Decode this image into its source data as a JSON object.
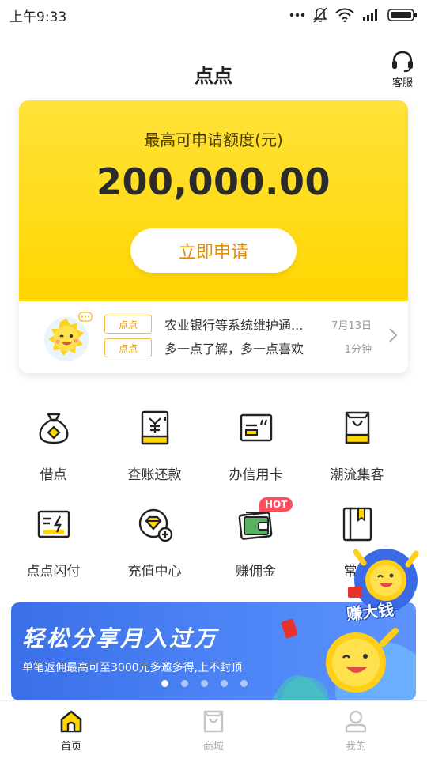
{
  "status_bar": {
    "time": "上午9:33"
  },
  "header": {
    "title": "点点",
    "service_label": "客服"
  },
  "hero": {
    "limit_label": "最高可申请额度(元)",
    "limit_amount": "200,000.00",
    "apply_label": "立即申请"
  },
  "notices": [
    {
      "tag": "点点",
      "text": "农业银行等系统维护通...",
      "time": "7月13日"
    },
    {
      "tag": "点点",
      "text": "多一点了解，多一点喜欢",
      "time": "1分钟"
    }
  ],
  "grid": [
    {
      "label": "借点",
      "icon": "money-bag-icon"
    },
    {
      "label": "查账还款",
      "icon": "bill-icon"
    },
    {
      "label": "办信用卡",
      "icon": "credit-card-icon"
    },
    {
      "label": "潮流集客",
      "icon": "shopping-bag-icon"
    },
    {
      "label": "点点闪付",
      "icon": "flash-pay-icon"
    },
    {
      "label": "充值中心",
      "icon": "recharge-icon"
    },
    {
      "label": "赚佣金",
      "icon": "wallet-icon",
      "badge": "HOT"
    },
    {
      "label": "常见",
      "icon": "book-icon"
    }
  ],
  "banner": {
    "title": "轻松分享月入过万",
    "subtitle": "单笔返佣最高可至3000元多邀多得,上不封顶",
    "dot_count": 5,
    "active_dot": 0
  },
  "earn_float_label": "赚大钱",
  "tabs": [
    {
      "label": "首页",
      "icon": "home-icon",
      "active": true
    },
    {
      "label": "商城",
      "icon": "mall-icon",
      "active": false
    },
    {
      "label": "我的",
      "icon": "profile-icon",
      "active": false
    }
  ],
  "colors": {
    "brand_yellow": "#ffd600",
    "accent_orange": "#e58e00",
    "hot_red": "#ff4d5b",
    "banner_blue": "#4f86f7"
  }
}
